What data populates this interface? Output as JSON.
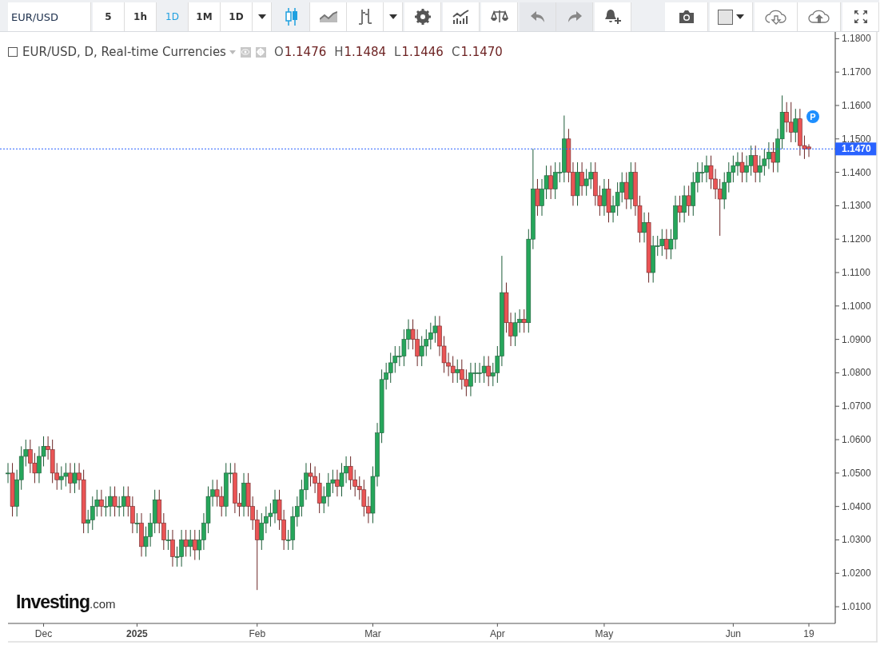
{
  "toolbar": {
    "symbol": "EUR/USD",
    "intervals": [
      {
        "label": "5",
        "selected": false
      },
      {
        "label": "1h",
        "selected": false
      },
      {
        "label": "1D",
        "selected": true
      },
      {
        "label": "1M",
        "selected": false
      },
      {
        "label": "1D",
        "selected": false
      }
    ],
    "chart_types": [
      {
        "selected": true
      },
      {
        "selected": false
      },
      {
        "selected": false
      }
    ]
  },
  "legend": {
    "title": "EUR/USD, D, Real-time Currencies",
    "ohlc": [
      {
        "label": "O",
        "value": "1.1476"
      },
      {
        "label": "H",
        "value": "1.1484"
      },
      {
        "label": "L",
        "value": "1.1446"
      },
      {
        "label": "C",
        "value": "1.1470"
      }
    ]
  },
  "logo": {
    "name": "Investing",
    "suffix": ".com"
  },
  "chart": {
    "chart_data": {
      "type": "candlestick",
      "categories": [
        null,
        null,
        null,
        null,
        null,
        null,
        null,
        null,
        "Dec",
        null,
        null,
        null,
        null,
        null,
        null,
        null,
        null,
        null,
        null,
        null,
        null,
        null,
        null,
        null,
        null,
        null,
        null,
        null,
        null,
        "2025",
        null,
        null,
        null,
        null,
        null,
        null,
        null,
        null,
        null,
        null,
        null,
        null,
        null,
        null,
        null,
        null,
        null,
        null,
        null,
        null,
        null,
        null,
        null,
        null,
        null,
        null,
        "Feb",
        null,
        null,
        null,
        null,
        null,
        null,
        null,
        null,
        null,
        null,
        null,
        null,
        null,
        null,
        null,
        null,
        null,
        null,
        null,
        null,
        null,
        null,
        null,
        null,
        null,
        "Mar",
        null,
        null,
        null,
        null,
        null,
        null,
        null,
        null,
        null,
        null,
        null,
        null,
        null,
        null,
        null,
        null,
        null,
        null,
        null,
        null,
        null,
        null,
        null,
        null,
        null,
        null,
        null,
        "Apr",
        null,
        null,
        null,
        null,
        null,
        null,
        null,
        null,
        null,
        null,
        null,
        null,
        null,
        null,
        null,
        null,
        null,
        null,
        null,
        null,
        null,
        null,
        null,
        "May",
        null,
        null,
        null,
        null,
        null,
        null,
        null,
        null,
        null,
        null,
        null,
        null,
        null,
        null,
        null,
        null,
        null,
        null,
        null,
        null,
        null,
        null,
        null,
        null,
        null,
        null,
        null,
        null,
        "Jun",
        null,
        null,
        null,
        null,
        null,
        null,
        null,
        null,
        null,
        null,
        null,
        null,
        null,
        null,
        null,
        null,
        "19"
      ],
      "ohlc": [
        [
          1.05,
          1.053,
          1.047,
          1.05
        ],
        [
          1.05,
          1.053,
          1.037,
          1.04
        ],
        [
          1.04,
          1.051,
          1.037,
          1.048
        ],
        [
          1.048,
          1.058,
          1.045,
          1.055
        ],
        [
          1.055,
          1.06,
          1.052,
          1.057
        ],
        [
          1.057,
          1.06,
          1.05,
          1.053
        ],
        [
          1.053,
          1.056,
          1.047,
          1.05
        ],
        [
          1.05,
          1.058,
          1.047,
          1.055
        ],
        [
          1.055,
          1.061,
          1.052,
          1.058
        ],
        [
          1.058,
          1.061,
          1.054,
          1.057
        ],
        [
          1.057,
          1.06,
          1.047,
          1.05
        ],
        [
          1.05,
          1.053,
          1.045,
          1.048
        ],
        [
          1.048,
          1.052,
          1.045,
          1.049
        ],
        [
          1.049,
          1.053,
          1.046,
          1.05
        ],
        [
          1.05,
          1.053,
          1.044,
          1.047
        ],
        [
          1.047,
          1.053,
          1.044,
          1.05
        ],
        [
          1.05,
          1.053,
          1.045,
          1.048
        ],
        [
          1.048,
          1.051,
          1.032,
          1.035
        ],
        [
          1.035,
          1.039,
          1.032,
          1.036
        ],
        [
          1.036,
          1.043,
          1.033,
          1.04
        ],
        [
          1.04,
          1.045,
          1.037,
          1.042
        ],
        [
          1.042,
          1.045,
          1.037,
          1.04
        ],
        [
          1.04,
          1.043,
          1.037,
          1.04
        ],
        [
          1.04,
          1.046,
          1.037,
          1.043
        ],
        [
          1.043,
          1.046,
          1.037,
          1.04
        ],
        [
          1.04,
          1.043,
          1.037,
          1.04
        ],
        [
          1.04,
          1.046,
          1.037,
          1.043
        ],
        [
          1.043,
          1.046,
          1.037,
          1.04
        ],
        [
          1.04,
          1.043,
          1.032,
          1.035
        ],
        [
          1.035,
          1.038,
          1.032,
          1.035
        ],
        [
          1.035,
          1.038,
          1.025,
          1.028
        ],
        [
          1.028,
          1.034,
          1.025,
          1.031
        ],
        [
          1.031,
          1.038,
          1.028,
          1.035
        ],
        [
          1.035,
          1.045,
          1.032,
          1.042
        ],
        [
          1.042,
          1.045,
          1.032,
          1.035
        ],
        [
          1.035,
          1.038,
          1.027,
          1.03
        ],
        [
          1.03,
          1.033,
          1.027,
          1.03
        ],
        [
          1.03,
          1.033,
          1.022,
          1.025
        ],
        [
          1.025,
          1.028,
          1.022,
          1.025
        ],
        [
          1.025,
          1.033,
          1.022,
          1.03
        ],
        [
          1.03,
          1.033,
          1.025,
          1.028
        ],
        [
          1.028,
          1.033,
          1.025,
          1.03
        ],
        [
          1.03,
          1.033,
          1.024,
          1.027
        ],
        [
          1.027,
          1.033,
          1.024,
          1.03
        ],
        [
          1.03,
          1.038,
          1.027,
          1.035
        ],
        [
          1.035,
          1.046,
          1.032,
          1.043
        ],
        [
          1.043,
          1.048,
          1.04,
          1.045
        ],
        [
          1.045,
          1.048,
          1.04,
          1.043
        ],
        [
          1.043,
          1.046,
          1.037,
          1.04
        ],
        [
          1.04,
          1.053,
          1.037,
          1.05
        ],
        [
          1.05,
          1.053,
          1.047,
          1.05
        ],
        [
          1.05,
          1.053,
          1.038,
          1.041
        ],
        [
          1.041,
          1.044,
          1.037,
          1.04
        ],
        [
          1.04,
          1.05,
          1.037,
          1.047
        ],
        [
          1.047,
          1.05,
          1.037,
          1.04
        ],
        [
          1.04,
          1.043,
          1.033,
          1.036
        ],
        [
          1.036,
          1.039,
          1.015,
          1.03
        ],
        [
          1.03,
          1.038,
          1.027,
          1.035
        ],
        [
          1.035,
          1.04,
          1.032,
          1.037
        ],
        [
          1.037,
          1.041,
          1.034,
          1.038
        ],
        [
          1.038,
          1.045,
          1.035,
          1.042
        ],
        [
          1.042,
          1.045,
          1.033,
          1.036
        ],
        [
          1.036,
          1.039,
          1.027,
          1.03
        ],
        [
          1.03,
          1.033,
          1.027,
          1.03
        ],
        [
          1.03,
          1.04,
          1.027,
          1.037
        ],
        [
          1.037,
          1.043,
          1.034,
          1.04
        ],
        [
          1.04,
          1.048,
          1.037,
          1.045
        ],
        [
          1.045,
          1.053,
          1.042,
          1.05
        ],
        [
          1.05,
          1.053,
          1.046,
          1.049
        ],
        [
          1.049,
          1.052,
          1.044,
          1.047
        ],
        [
          1.047,
          1.05,
          1.038,
          1.041
        ],
        [
          1.041,
          1.046,
          1.038,
          1.043
        ],
        [
          1.043,
          1.05,
          1.04,
          1.047
        ],
        [
          1.047,
          1.051,
          1.044,
          1.048
        ],
        [
          1.048,
          1.051,
          1.043,
          1.046
        ],
        [
          1.046,
          1.053,
          1.043,
          1.05
        ],
        [
          1.05,
          1.055,
          1.047,
          1.052
        ],
        [
          1.052,
          1.055,
          1.045,
          1.048
        ],
        [
          1.048,
          1.051,
          1.043,
          1.046
        ],
        [
          1.046,
          1.049,
          1.042,
          1.045
        ],
        [
          1.045,
          1.048,
          1.037,
          1.04
        ],
        [
          1.04,
          1.043,
          1.035,
          1.038
        ],
        [
          1.038,
          1.052,
          1.035,
          1.049
        ],
        [
          1.049,
          1.065,
          1.046,
          1.062
        ],
        [
          1.062,
          1.081,
          1.059,
          1.078
        ],
        [
          1.078,
          1.083,
          1.075,
          1.08
        ],
        [
          1.08,
          1.086,
          1.077,
          1.083
        ],
        [
          1.083,
          1.088,
          1.08,
          1.085
        ],
        [
          1.085,
          1.088,
          1.082,
          1.085
        ],
        [
          1.085,
          1.093,
          1.082,
          1.09
        ],
        [
          1.09,
          1.096,
          1.087,
          1.093
        ],
        [
          1.093,
          1.096,
          1.087,
          1.09
        ],
        [
          1.09,
          1.093,
          1.082,
          1.085
        ],
        [
          1.085,
          1.091,
          1.082,
          1.088
        ],
        [
          1.088,
          1.093,
          1.085,
          1.09
        ],
        [
          1.09,
          1.095,
          1.087,
          1.092
        ],
        [
          1.092,
          1.097,
          1.089,
          1.094
        ],
        [
          1.094,
          1.097,
          1.085,
          1.088
        ],
        [
          1.088,
          1.091,
          1.08,
          1.083
        ],
        [
          1.083,
          1.086,
          1.079,
          1.082
        ],
        [
          1.082,
          1.085,
          1.077,
          1.08
        ],
        [
          1.08,
          1.084,
          1.077,
          1.081
        ],
        [
          1.081,
          1.084,
          1.075,
          1.078
        ],
        [
          1.078,
          1.081,
          1.073,
          1.076
        ],
        [
          1.076,
          1.083,
          1.073,
          1.08
        ],
        [
          1.08,
          1.083,
          1.077,
          1.08
        ],
        [
          1.08,
          1.083,
          1.077,
          1.08
        ],
        [
          1.08,
          1.085,
          1.077,
          1.082
        ],
        [
          1.082,
          1.085,
          1.076,
          1.079
        ],
        [
          1.079,
          1.083,
          1.076,
          1.08
        ],
        [
          1.08,
          1.088,
          1.077,
          1.085
        ],
        [
          1.085,
          1.115,
          1.082,
          1.104
        ],
        [
          1.104,
          1.107,
          1.092,
          1.095
        ],
        [
          1.095,
          1.098,
          1.088,
          1.091
        ],
        [
          1.091,
          1.098,
          1.088,
          1.095
        ],
        [
          1.095,
          1.099,
          1.092,
          1.096
        ],
        [
          1.096,
          1.099,
          1.092,
          1.095
        ],
        [
          1.095,
          1.123,
          1.092,
          1.12
        ],
        [
          1.12,
          1.147,
          1.117,
          1.135
        ],
        [
          1.135,
          1.138,
          1.127,
          1.13
        ],
        [
          1.13,
          1.138,
          1.127,
          1.135
        ],
        [
          1.135,
          1.142,
          1.132,
          1.139
        ],
        [
          1.139,
          1.142,
          1.132,
          1.135
        ],
        [
          1.135,
          1.143,
          1.132,
          1.14
        ],
        [
          1.14,
          1.143,
          1.137,
          1.14
        ],
        [
          1.14,
          1.157,
          1.137,
          1.15
        ],
        [
          1.15,
          1.153,
          1.137,
          1.14
        ],
        [
          1.14,
          1.143,
          1.13,
          1.133
        ],
        [
          1.133,
          1.143,
          1.13,
          1.14
        ],
        [
          1.14,
          1.143,
          1.133,
          1.136
        ],
        [
          1.136,
          1.141,
          1.133,
          1.138
        ],
        [
          1.138,
          1.143,
          1.135,
          1.14
        ],
        [
          1.14,
          1.143,
          1.13,
          1.133
        ],
        [
          1.133,
          1.136,
          1.127,
          1.13
        ],
        [
          1.13,
          1.138,
          1.127,
          1.135
        ],
        [
          1.135,
          1.138,
          1.125,
          1.128
        ],
        [
          1.128,
          1.133,
          1.125,
          1.13
        ],
        [
          1.13,
          1.137,
          1.127,
          1.134
        ],
        [
          1.134,
          1.14,
          1.131,
          1.137
        ],
        [
          1.137,
          1.14,
          1.129,
          1.132
        ],
        [
          1.132,
          1.143,
          1.129,
          1.14
        ],
        [
          1.14,
          1.143,
          1.127,
          1.13
        ],
        [
          1.13,
          1.133,
          1.119,
          1.122
        ],
        [
          1.122,
          1.128,
          1.119,
          1.125
        ],
        [
          1.125,
          1.128,
          1.107,
          1.11
        ],
        [
          1.11,
          1.121,
          1.107,
          1.118
        ],
        [
          1.118,
          1.121,
          1.115,
          1.118
        ],
        [
          1.118,
          1.123,
          1.115,
          1.12
        ],
        [
          1.12,
          1.123,
          1.114,
          1.117
        ],
        [
          1.117,
          1.123,
          1.114,
          1.12
        ],
        [
          1.12,
          1.133,
          1.117,
          1.13
        ],
        [
          1.13,
          1.133,
          1.125,
          1.128
        ],
        [
          1.128,
          1.136,
          1.125,
          1.133
        ],
        [
          1.133,
          1.136,
          1.127,
          1.13
        ],
        [
          1.13,
          1.14,
          1.127,
          1.137
        ],
        [
          1.137,
          1.143,
          1.134,
          1.14
        ],
        [
          1.14,
          1.143,
          1.137,
          1.14
        ],
        [
          1.14,
          1.145,
          1.137,
          1.142
        ],
        [
          1.142,
          1.145,
          1.135,
          1.138
        ],
        [
          1.138,
          1.141,
          1.132,
          1.135
        ],
        [
          1.135,
          1.138,
          1.121,
          1.132
        ],
        [
          1.132,
          1.14,
          1.129,
          1.137
        ],
        [
          1.137,
          1.143,
          1.134,
          1.14
        ],
        [
          1.14,
          1.145,
          1.137,
          1.142
        ],
        [
          1.142,
          1.146,
          1.139,
          1.143
        ],
        [
          1.143,
          1.146,
          1.137,
          1.14
        ],
        [
          1.14,
          1.145,
          1.137,
          1.142
        ],
        [
          1.142,
          1.148,
          1.139,
          1.145
        ],
        [
          1.145,
          1.148,
          1.137,
          1.14
        ],
        [
          1.14,
          1.145,
          1.137,
          1.142
        ],
        [
          1.142,
          1.147,
          1.139,
          1.144
        ],
        [
          1.144,
          1.149,
          1.141,
          1.146
        ],
        [
          1.146,
          1.149,
          1.14,
          1.143
        ],
        [
          1.143,
          1.153,
          1.14,
          1.15
        ],
        [
          1.15,
          1.163,
          1.147,
          1.158
        ],
        [
          1.158,
          1.161,
          1.152,
          1.155
        ],
        [
          1.155,
          1.161,
          1.149,
          1.152
        ],
        [
          1.152,
          1.159,
          1.149,
          1.156
        ],
        [
          1.156,
          1.159,
          1.145,
          1.148
        ],
        [
          1.148,
          1.151,
          1.144,
          1.147
        ],
        [
          1.1476,
          1.1484,
          1.1446,
          1.147
        ]
      ],
      "ylim": [
        1.005,
        1.182
      ],
      "yticks": [
        {
          "value": 1.18,
          "label": "1.1800"
        },
        {
          "value": 1.17,
          "label": "1.1700"
        },
        {
          "value": 1.16,
          "label": "1.1600"
        },
        {
          "value": 1.15,
          "label": "1.1500"
        },
        {
          "value": 1.14,
          "label": "1.1400"
        },
        {
          "value": 1.13,
          "label": "1.1300"
        },
        {
          "value": 1.12,
          "label": "1.1200"
        },
        {
          "value": 1.11,
          "label": "1.1100"
        },
        {
          "value": 1.1,
          "label": "1.1000"
        },
        {
          "value": 1.09,
          "label": "1.0900"
        },
        {
          "value": 1.08,
          "label": "1.0800"
        },
        {
          "value": 1.07,
          "label": "1.0700"
        },
        {
          "value": 1.06,
          "label": "1.0600"
        },
        {
          "value": 1.05,
          "label": "1.0500"
        },
        {
          "value": 1.04,
          "label": "1.0400"
        },
        {
          "value": 1.03,
          "label": "1.0300"
        },
        {
          "value": 1.02,
          "label": "1.0200"
        },
        {
          "value": 1.01,
          "label": "1.0100"
        }
      ],
      "ref_lines": [
        {
          "axis": "y",
          "value": 1.147,
          "label": "1.1470"
        }
      ]
    },
    "marker": {
      "label": "P"
    }
  }
}
